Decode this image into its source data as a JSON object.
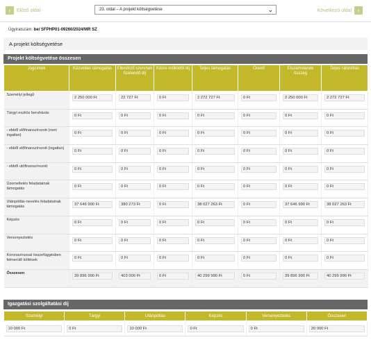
{
  "nav": {
    "prev_label": "Előző oldal",
    "next_label": "Következő oldal",
    "page_select_value": "23. oldal – A projekt költségvetése"
  },
  "ugyirat": {
    "label": "Ügyiratszám:",
    "value": "be/ SFPHP01-09260/2024/MR SZ"
  },
  "page_title": "A projekt költségvetése",
  "summary": {
    "title": "Projekt költségvetése összesen",
    "columns": [
      "Jogcímek",
      "Közvetlen támogatás",
      "Ellenőrző szervnek fizetendő díj",
      "Közre-működői díj",
      "Teljes támogatás",
      "Önerő",
      "Elszámolandó összeg",
      "Teljes ráfordítás"
    ],
    "rows": [
      {
        "label": "Személyi jellegű",
        "values": [
          "2 250 000 Ft",
          "22 727 Ft",
          "0 Ft",
          "2 272 727 Ft",
          "0 Ft",
          "2 250 000 Ft",
          "2 272 727 Ft"
        ]
      },
      {
        "label": "Tárgyi eszköz beruházás",
        "values": [
          "0 Ft",
          "0 Ft",
          "0 Ft",
          "0 Ft",
          "0 Ft",
          "0 Ft",
          "0 Ft"
        ]
      },
      {
        "label": "- ebből előfinanszírozott (nem ingatlan)",
        "values": [
          "0 Ft",
          "0 Ft",
          "0 Ft",
          "0 Ft",
          "0 Ft",
          "0 Ft",
          "0 Ft"
        ]
      },
      {
        "label": "- ebből előfinanszírozott (ingatlan)",
        "values": [
          "0 Ft",
          "0 Ft",
          "0 Ft",
          "0 Ft",
          "0 Ft",
          "0 Ft",
          "0 Ft"
        ]
      },
      {
        "label": "- ebből utófinanszírozott",
        "values": [
          "0 Ft",
          "0 Ft",
          "0 Ft",
          "0 Ft",
          "0 Ft",
          "0 Ft",
          "0 Ft"
        ]
      },
      {
        "label": "Üzemeltetés feladatainak támogatás",
        "values": [
          "0 Ft",
          "0 Ft",
          "0 Ft",
          "0 Ft",
          "0 Ft",
          "0 Ft",
          "0 Ft"
        ]
      },
      {
        "label": "Utánpótlás-nevelés feladatainak támogatás",
        "values": [
          "37 646 990 Ft",
          "380 273 Ft",
          "0 Ft",
          "38 027 263 Ft",
          "0 Ft",
          "37 646 990 Ft",
          "38 027 263 Ft"
        ]
      },
      {
        "label": "Képzés",
        "values": [
          "0 Ft",
          "0 Ft",
          "0 Ft",
          "0 Ft",
          "0 Ft",
          "0 Ft",
          "0 Ft"
        ]
      },
      {
        "label": "Versenyeztetés",
        "values": [
          "0 Ft",
          "0 Ft",
          "0 Ft",
          "0 Ft",
          "0 Ft",
          "0 Ft",
          "0 Ft"
        ]
      },
      {
        "label": "Koronavírussal összefüggésben felmerülő költések",
        "values": [
          "0 Ft",
          "0 Ft",
          "0 Ft",
          "0 Ft",
          "0 Ft",
          "0 Ft",
          "0 Ft"
        ]
      }
    ],
    "total": {
      "label": "Összesen",
      "values": [
        "39 896 990 Ft",
        "403 000 Ft",
        "0 Ft",
        "40 299 990 Ft",
        "0 Ft",
        "39 896 990 Ft",
        "40 299 990 Ft"
      ]
    }
  },
  "fees": {
    "title": "Igazgatási szolgáltatási díj",
    "columns": [
      "Személyi",
      "Tárgyi",
      "Utánpótlás",
      "Képzés",
      "Versenyeztetés",
      "Összesen"
    ],
    "values": [
      "10 000 Ft",
      "0 Ft",
      "10 000 Ft",
      "0 Ft",
      "0 Ft",
      "20 000 Ft"
    ]
  },
  "colors": {
    "accent": "#c2b82a",
    "section_header": "#666666",
    "nav_disabled": "#c8cc8a"
  }
}
